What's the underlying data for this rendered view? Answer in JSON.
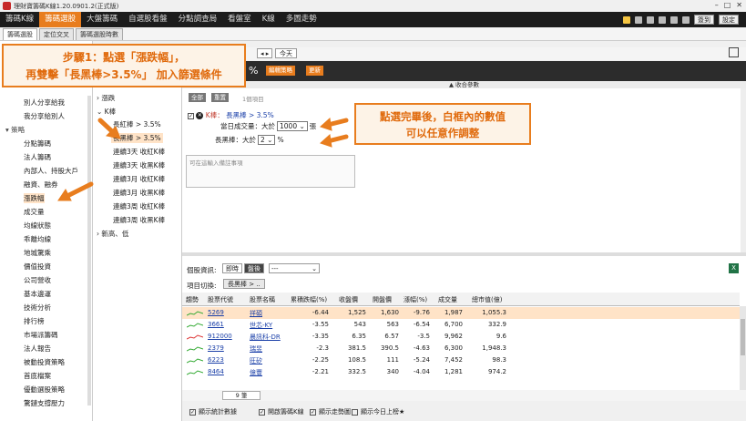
{
  "window": {
    "title": "理財寶籌碼K線1.20.0901.2(正式版)"
  },
  "menu": {
    "items": [
      "籌碼K線",
      "籌碼選股",
      "大盤籌碼",
      "自選股看盤",
      "分點調查局",
      "看盤室",
      "K線",
      "多圖走勢"
    ],
    "right_buttons": [
      "簽到",
      "設定"
    ]
  },
  "subtabs": [
    "籌碼選股",
    "定位交叉",
    "籌碼選股時數"
  ],
  "leftnav": {
    "items_top": [
      "別人分享給我",
      "我分享給別人"
    ],
    "section": "策略",
    "items": [
      "分點籌碼",
      "法人籌碼",
      "內部人、持股大戶",
      "融資、融券",
      "漲跌幅",
      "成交量",
      "均線狀態",
      "乖離均線",
      "地城驚乘",
      "價值投資",
      "公司營收",
      "基本邊運",
      "技術分析",
      "排行榜",
      "市場派籌碼",
      "法人報告",
      "被動投資策略",
      "首底檔案",
      "優動選股策略",
      "驚鏈支撐壓力"
    ]
  },
  "tree": {
    "nodes": [
      "漲跌",
      "K棒",
      "長紅棒 > 3.5%",
      "長黑棒 > 3.5%",
      "連續3天 收紅K棒",
      "連續3天 收黑K棒",
      "連續3月 收紅K棒",
      "連續3月 收黑K棒",
      "連續3周 收紅K棒",
      "連續3周 收黑K棒",
      "新高、低"
    ]
  },
  "toolbar": {
    "prev": "◂ ▸",
    "today": "今天"
  },
  "band": {
    "pct": "%",
    "btn1": "編輯策略",
    "btn2": "更新"
  },
  "collapse_label": "▲ 收合參數",
  "conditions": {
    "btn1": "全部",
    "btn2": "重置",
    "count": "1個項目",
    "category": "K棒：",
    "name": "長黑棒 > 3.5%",
    "vol_label": "當日成交量：大於",
    "vol_value": "1000",
    "vol_unit": "張",
    "body_label": "長黑棒：大於",
    "body_value": "2",
    "body_unit": "%",
    "note_placeholder": "可在這輸入備註事項"
  },
  "stockinfo": {
    "label": "個股資訊:",
    "seg1": "即時",
    "seg2": "盤後",
    "dropdown": "---",
    "tab_label": "項目切換:",
    "tab": "長黑棒 > ..",
    "excel": "X"
  },
  "table": {
    "headers": [
      "趨勢",
      "股票代號",
      "股票名稱",
      "累積跌幅(%)",
      "收盤價",
      "開盤價",
      "漲幅(%)",
      "成交量",
      "總市值(億)"
    ],
    "rows": [
      {
        "code": "5269",
        "name": "祥碩",
        "cum": "-6.44",
        "close": "1,525",
        "open": "1,630",
        "chg": "-9.76",
        "vol": "1,987",
        "cap": "1,055.3"
      },
      {
        "code": "3661",
        "name": "世芯-KY",
        "cum": "-3.55",
        "close": "543",
        "open": "563",
        "chg": "-6.54",
        "vol": "6,700",
        "cap": "332.9"
      },
      {
        "code": "912000",
        "name": "晨訊科-DR",
        "cum": "-3.35",
        "close": "6.35",
        "open": "6.57",
        "chg": "-3.5",
        "vol": "9,962",
        "cap": "9.6"
      },
      {
        "code": "2379",
        "name": "瑞昱",
        "cum": "-2.3",
        "close": "381.5",
        "open": "390.5",
        "chg": "-4.63",
        "vol": "6,300",
        "cap": "1,948.3"
      },
      {
        "code": "6223",
        "name": "旺矽",
        "cum": "-2.25",
        "close": "108.5",
        "open": "111",
        "chg": "-5.24",
        "vol": "7,452",
        "cap": "98.3"
      },
      {
        "code": "8464",
        "name": "億豐",
        "cum": "-2.21",
        "close": "332.5",
        "open": "340",
        "chg": "-4.04",
        "vol": "1,281",
        "cap": "974.2"
      }
    ]
  },
  "pager": {
    "count": "9 筆"
  },
  "footer": [
    "顯示統計數據",
    "開啟籌碼K線",
    "顯示走勢圖",
    "顯示今日上榜★"
  ],
  "callouts": {
    "step1_line1": "步驟1：點選「漲跌幅」，",
    "step1_line2": "再雙擊「長黑棒>3.5%」 加入篩選條件",
    "step2_line1": "點選完畢後，白框內的數值",
    "step2_line2": "可以任意作調整"
  }
}
